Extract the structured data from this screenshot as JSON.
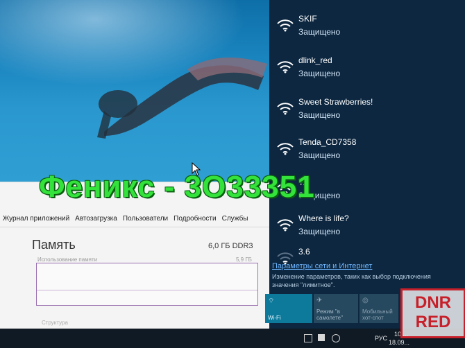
{
  "wifi_networks": [
    {
      "name": "SKIF",
      "status": "Защищено"
    },
    {
      "name": "dlink_red",
      "status": "Защищено"
    },
    {
      "name": "Sweet Strawberries!",
      "status": "Защищено"
    },
    {
      "name": "Tenda_CD7358",
      "status": "Защищено"
    },
    {
      "name": "T...",
      "status": "Защищено"
    },
    {
      "name": "Where is life?",
      "status": "Защищено"
    },
    {
      "name": "3.6",
      "status": ""
    }
  ],
  "network_settings": {
    "link": "Параметры сети и Интернет",
    "description": "Изменение параметров, таких как выбор подключения значения \"лимитное\"."
  },
  "quick_actions": [
    {
      "label": "Wi-Fi",
      "icon": "wifi-icon"
    },
    {
      "label": "Режим \"в самолете\"",
      "icon": "airplane-icon"
    },
    {
      "label": "Мобильный хот-спот",
      "icon": "hotspot-icon"
    }
  ],
  "task_manager": {
    "tabs": [
      "Журнал приложений",
      "Автозагрузка",
      "Пользователи",
      "Подробности",
      "Службы"
    ],
    "memory_title": "Память",
    "memory_size": "6,0 ГБ DDR3",
    "usage_label": "Использование памяти",
    "usage_max": "5,9 ГБ",
    "composition_label": "Структура"
  },
  "taskbar": {
    "language": "РУС",
    "time": "10:...",
    "date": "18.09..."
  },
  "watermark": "Феникс - 3О33351",
  "logo": {
    "line1": "DNR",
    "line2": "RED"
  },
  "colors": {
    "panel_bg": "#0d2740",
    "link": "#6fb7ff",
    "tile_active": "#0e7a9b",
    "watermark": "#33e23a",
    "logo_red": "#c8202a"
  }
}
